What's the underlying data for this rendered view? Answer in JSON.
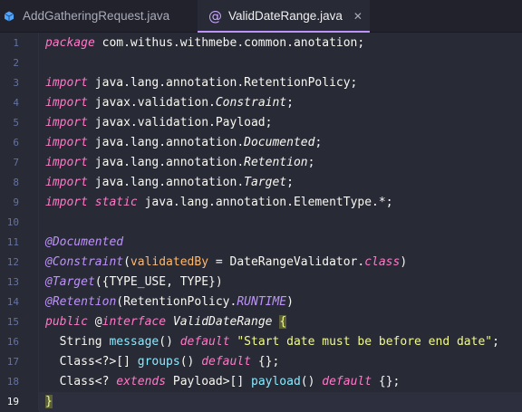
{
  "tabs": [
    {
      "label": "AddGatheringRequest.java",
      "active": false
    },
    {
      "label": "ValidDateRange.java",
      "active": true
    }
  ],
  "colors": {
    "background": "#282a36",
    "keyword": "#ff79c6",
    "annotation": "#bd93f9",
    "string": "#f1fa8c",
    "function": "#8be9fd",
    "line_number": "#6272a4",
    "tab_accent": "#bd93f9"
  },
  "editor": {
    "line_numbers": [
      "1",
      "2",
      "3",
      "4",
      "5",
      "6",
      "7",
      "8",
      "9",
      "10",
      "11",
      "12",
      "13",
      "14",
      "15",
      "16",
      "17",
      "18",
      "19"
    ],
    "current_line": 19,
    "lines": {
      "l1_kw": "package",
      "l1_rest": " com.withus.withmebe.common.anotation;",
      "import_kw": "import",
      "static_kw": "static",
      "l3": " java.lang.annotation.RetentionPolicy;",
      "l4_pkg": " javax.validation.",
      "l4_cls": "Constraint",
      "l5_pkg": " javax.validation.Payload;",
      "l6_pkg": " java.lang.annotation.",
      "l6_cls": "Documented",
      "l7_pkg": " java.lang.annotation.",
      "l7_cls": "Retention",
      "l8_pkg": " java.lang.annotation.",
      "l8_cls": "Target",
      "l9_rest": " java.lang.annotation.ElementType.*;",
      "semi": ";",
      "l11": "@Documented",
      "l12_ann": "@Constraint",
      "l12_open": "(",
      "l12_param": "validatedBy",
      "l12_mid": " = DateRangeValidator.",
      "l12_class": "class",
      "l12_close": ")",
      "l13_ann": "@Target",
      "l13_rest": "({TYPE_USE, TYPE})",
      "l14_ann": "@Retention",
      "l14_pre": "(RetentionPolicy.",
      "l14_fld": "RUNTIME",
      "l14_post": ")",
      "l15_pub": "public",
      "l15_at": " @",
      "l15_iface": "interface",
      "l15_name": " ValidDateRange ",
      "l15_brace": "{",
      "l16_type": "  String ",
      "l16_fn": "message",
      "l16_parens": "() ",
      "l16_default": "default",
      "l16_str": " \"Start date must be before end date\"",
      "l16_semi": ";",
      "l17_type": "  Class<?>[] ",
      "l17_fn": "groups",
      "l17_parens": "() ",
      "l17_default": "default",
      "l17_rest": " {};",
      "l18_type": "  Class<? ",
      "l18_extends": "extends",
      "l18_mid": " Payload>[] ",
      "l18_fn": "payload",
      "l18_parens": "() ",
      "l18_default": "default",
      "l18_rest": " {};",
      "l19_brace": "}"
    }
  }
}
